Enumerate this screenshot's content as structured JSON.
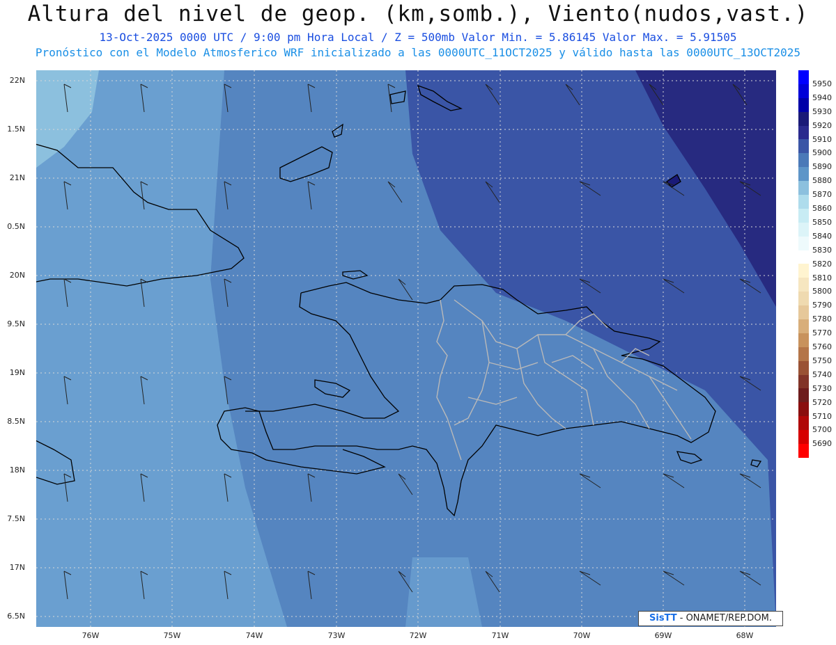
{
  "header": {
    "title": "Altura del nivel de geop. (km,somb.), Viento(nudos,vast.)",
    "line1": "13-Oct-2025  0000 UTC / 9:00 pm Hora Local / Z = 500mb     Valor Min. = 5.86145  Valor Max. = 5.91505",
    "line2": "Pronóstico con el Modelo Atmosferico WRF inicializado a las 0000UTC_11OCT2025 y válido hasta las  0000UTC_13OCT2025"
  },
  "axes": {
    "lat_labels": [
      "22N",
      "1.5N",
      "21N",
      "0.5N",
      "20N",
      "9.5N",
      "19N",
      "8.5N",
      "18N",
      "7.5N",
      "17N",
      "6.5N"
    ],
    "lon_labels": [
      "76W",
      "75W",
      "74W",
      "73W",
      "72W",
      "71W",
      "70W",
      "69W",
      "68W"
    ]
  },
  "colorbar": {
    "labels": [
      "5950",
      "5940",
      "5930",
      "5920",
      "5910",
      "5900",
      "5890",
      "5880",
      "5870",
      "5860",
      "5850",
      "5840",
      "5830",
      "5820",
      "5810",
      "5800",
      "5790",
      "5780",
      "5770",
      "5760",
      "5750",
      "5740",
      "5730",
      "5720",
      "5710",
      "5700",
      "5690"
    ],
    "colors": [
      "#0000ff",
      "#0000d8",
      "#0000a8",
      "#1a1a78",
      "#2a2a8e",
      "#3a55a6",
      "#4a79b8",
      "#5d95c8",
      "#8cc0de",
      "#aedcec",
      "#c8ecf4",
      "#dcf4f8",
      "#eefafc",
      "#ffffff",
      "#fff4d0",
      "#f6e6c0",
      "#efdab0",
      "#e6c89a",
      "#d8ae7a",
      "#c8925c",
      "#b47548",
      "#9a5234",
      "#823428",
      "#6e1c1c",
      "#8a0e0e",
      "#b00808",
      "#d60000",
      "#ff0000"
    ]
  },
  "map": {
    "colors": {
      "west": "#6a9fd0",
      "mid": "#5585c0",
      "east": "#3a55a6",
      "far_ne": "#272a80",
      "light": "#8cc0de",
      "coast": "#000000",
      "province": "#b9b9b9"
    }
  },
  "credit": {
    "sis": "SisTT",
    "rest": "- ONAMET/REP.DOM."
  }
}
